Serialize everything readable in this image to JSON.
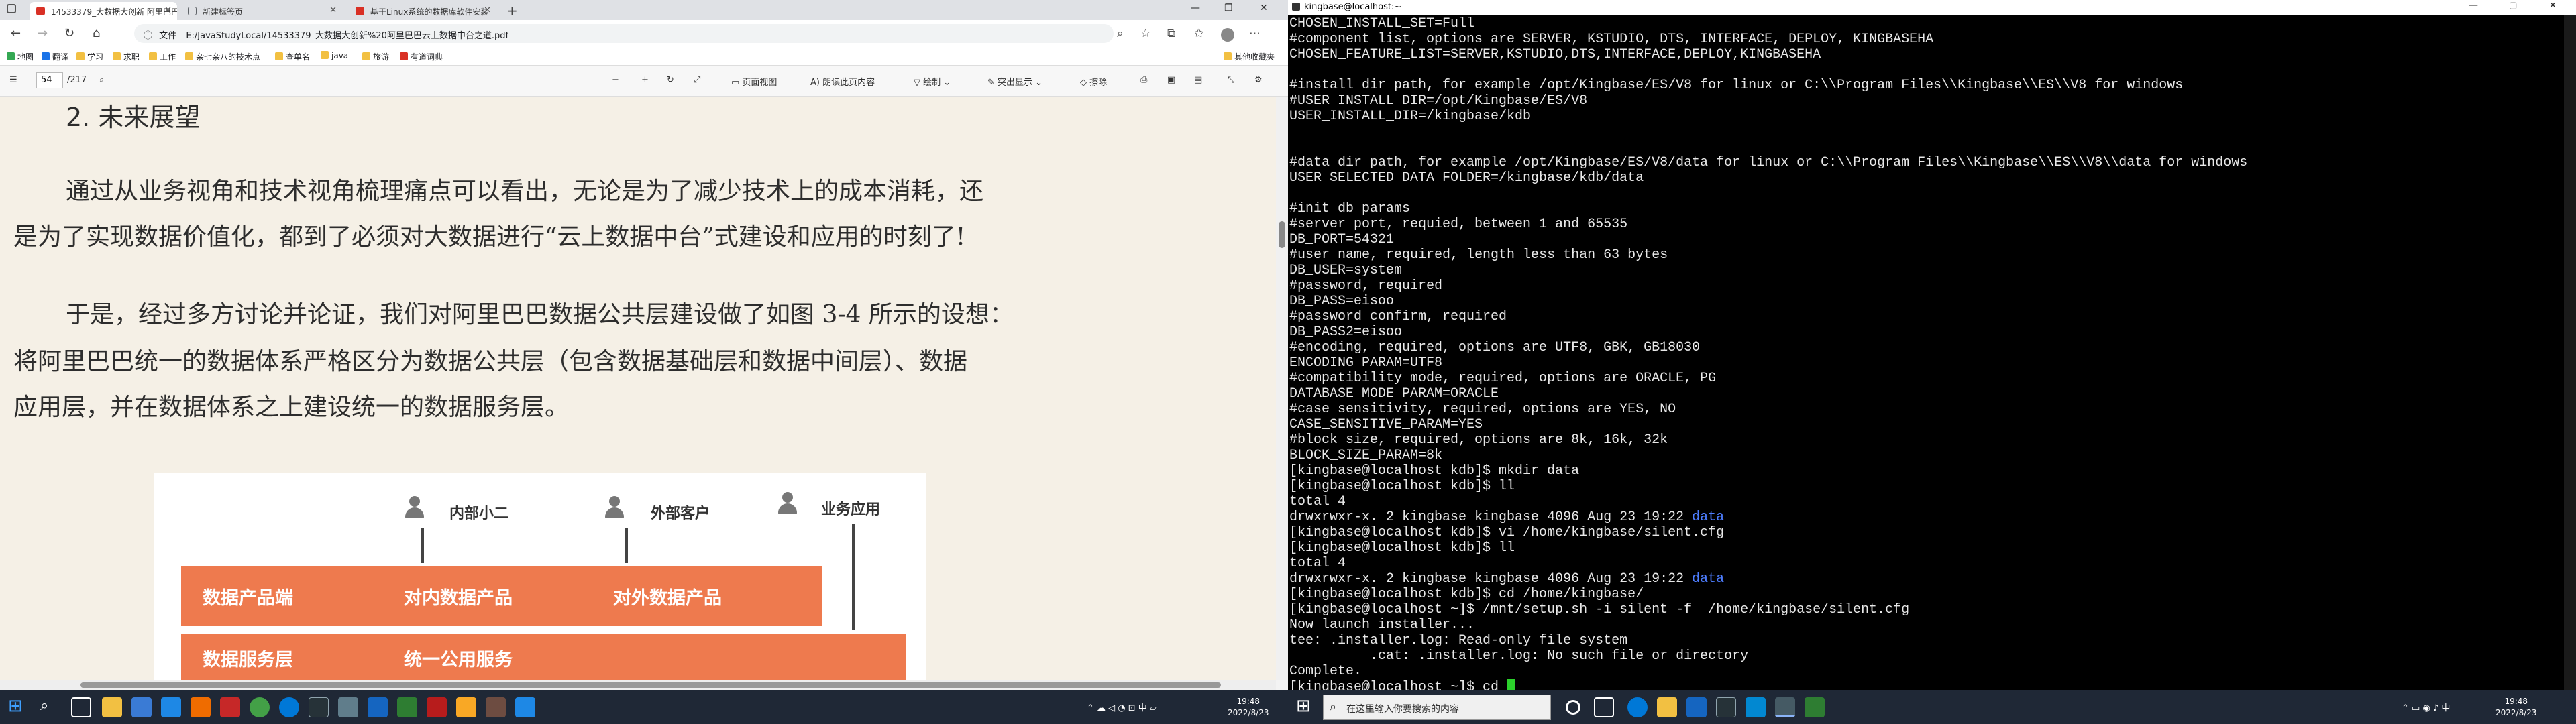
{
  "browser": {
    "tabs": [
      {
        "label": "14533379_大数据大创新 阿里巴巴",
        "color": "#d93025"
      },
      {
        "label": "新建标签页",
        "color": "#5f6368"
      },
      {
        "label": "基于Linux系统的数据库软件安装",
        "color": "#d93025"
      }
    ],
    "new_tab": "+",
    "url_prefix": "文件",
    "url": "E:/JavaStudyLocal/14533379_大数据大创新%20阿里巴巴云上数据中台之道.pdf",
    "favorites": [
      "地图",
      "翻译",
      "学习",
      "求职",
      "工作",
      "杂七杂八的技术点",
      "查单名",
      "java",
      "旅游",
      "有道词典"
    ],
    "other_favorites": "其他收藏夹",
    "pdf_toolbar": {
      "page_current": "54",
      "page_total": "/217",
      "page_view": "页面视图",
      "read_aloud": "朗读此页内容",
      "draw": "绘制",
      "highlight": "突出显示",
      "erase": "擦除"
    },
    "content": {
      "heading": "2.  未来展望",
      "para1_line1": "通过从业务视角和技术视角梳理痛点可以看出，无论是为了减少技术上的成本消耗，还",
      "para1_line2": "是为了实现数据价值化，都到了必须对大数据进行“云上数据中台”式建设和应用的时刻了!",
      "para2_line1": "于是，经过多方讨论并论证，我们对阿里巴巴数据公共层建设做了如图 3-4 所示的设想：",
      "para2_line2": "将阿里巴巴统一的数据体系严格区分为数据公共层（包含数据基础层和数据中间层）、数据",
      "para2_line3": "应用层，并在数据体系之上建设统一的数据服务层。",
      "diagram": {
        "actor1": "内部小二",
        "actor2": "外部客户",
        "actor3": "业务应用",
        "band1_title": "数据产品端",
        "band1_a": "对内数据产品",
        "band1_b": "对外数据产品",
        "band2_title": "数据服务层",
        "band2_a": "统一公用服务"
      }
    }
  },
  "taskbar_left": {
    "clock_time": "19:48",
    "clock_date": "2022/8/23"
  },
  "terminal": {
    "title": "kingbase@localhost:~",
    "lines": [
      "CHOSEN_INSTALL_SET=Full",
      "#component list, options are SERVER, KSTUDIO, DTS, INTERFACE, DEPLOY, KINGBASEHA",
      "CHOSEN_FEATURE_LIST=SERVER,KSTUDIO,DTS,INTERFACE,DEPLOY,KINGBASEHA",
      "",
      "#install dir path, for example /opt/Kingbase/ES/V8 for linux or C:\\\\Program Files\\\\Kingbase\\\\ES\\\\V8 for windows",
      "#USER_INSTALL_DIR=/opt/Kingbase/ES/V8",
      "USER_INSTALL_DIR=/kingbase/kdb",
      "",
      "",
      "#data dir path, for example /opt/Kingbase/ES/V8/data for linux or C:\\\\Program Files\\\\Kingbase\\\\ES\\\\V8\\\\data for windows",
      "USER_SELECTED_DATA_FOLDER=/kingbase/kdb/data",
      "",
      "#init db params",
      "#server port, requied, between 1 and 65535",
      "DB_PORT=54321",
      "#user name, required, length less than 63 bytes",
      "DB_USER=system",
      "#password, required",
      "DB_PASS=eisoo",
      "#password confirm, required",
      "DB_PASS2=eisoo",
      "#encoding, required, options are UTF8, GBK, GB18030",
      "ENCODING_PARAM=UTF8",
      "#compatibility mode, required, options are ORACLE, PG",
      "DATABASE_MODE_PARAM=ORACLE",
      "#case sensitivity, required, options are YES, NO",
      "CASE_SENSITIVE_PARAM=YES",
      "#block size, required, options are 8k, 16k, 32k",
      "BLOCK_SIZE_PARAM=8k",
      "[kingbase@localhost kdb]$ mkdir data",
      "[kingbase@localhost kdb]$ ll",
      "total 4",
      "drwxrwxr-x. 2 kingbase kingbase 4096 Aug 23 19:22 ",
      "[kingbase@localhost kdb]$ vi /home/kingbase/silent.cfg",
      "[kingbase@localhost kdb]$ ll",
      "total 4",
      "drwxrwxr-x. 2 kingbase kingbase 4096 Aug 23 19:22 ",
      "[kingbase@localhost kdb]$ cd /home/kingbase/",
      "[kingbase@localhost ~]$ /mnt/setup.sh -i silent -f  /home/kingbase/silent.cfg",
      "Now launch installer...",
      "tee: .installer.log: Read-only file system",
      "          .cat: .installer.log: No such file or directory",
      "Complete.",
      "[kingbase@localhost ~]$ cd "
    ],
    "dir_name": "data",
    "dir_color": "#4d7dff",
    "cursor_color": "#2bd12b"
  },
  "taskbar_right": {
    "search_placeholder": "在这里输入你要搜索的内容",
    "clock_time": "19:48",
    "clock_date": "2022/8/23"
  }
}
